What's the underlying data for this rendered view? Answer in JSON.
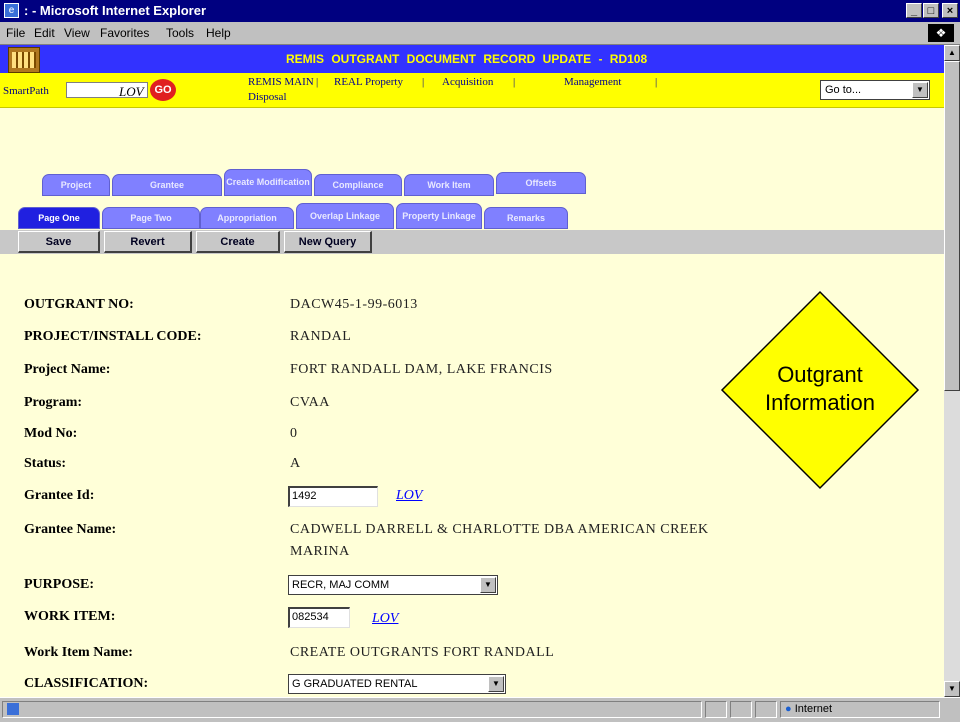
{
  "window": {
    "title": ": - Microsoft Internet Explorer",
    "min": "_",
    "max": "□",
    "close": "×"
  },
  "menu": [
    "File",
    "Edit",
    "View",
    "Favorites",
    "Tools",
    "Help"
  ],
  "app": {
    "header": "REMIS  OUTGRANT  DOCUMENT  RECORD  UPDATE  -  RD108",
    "smartpath_label": "SmartPath",
    "smartpath_value": "",
    "lov_label": "LOV",
    "go_label": "GO",
    "nav": [
      "REMIS MAIN",
      "|",
      "REAL Property",
      "|",
      "Acquisition",
      "|",
      "Management",
      "|",
      "Disposal"
    ],
    "goto_label": "Go to..."
  },
  "tabs_row1": [
    "Project",
    "Grantee",
    "Create Modification",
    "Compliance",
    "Work Item",
    "Offsets"
  ],
  "tabs_row2": [
    "Page One",
    "Page Two",
    "Appropriation",
    "Overlap Linkage",
    "Property Linkage",
    "Remarks"
  ],
  "buttons": {
    "save": "Save",
    "revert": "Revert",
    "create": "Create",
    "new_query": "New Query"
  },
  "form": {
    "outgrant_no": {
      "label": "OUTGRANT NO:",
      "value": "DACW45-1-99-6013"
    },
    "project_code": {
      "label": "PROJECT/INSTALL CODE:",
      "value": "RANDAL"
    },
    "project_name": {
      "label": "Project Name:",
      "value": "FORT RANDALL DAM, LAKE FRANCIS"
    },
    "program": {
      "label": "Program:",
      "value": "CVAA"
    },
    "mod_no": {
      "label": "Mod No:",
      "value": "0"
    },
    "status": {
      "label": "Status:",
      "value": "A"
    },
    "grantee_id": {
      "label": "Grantee Id:",
      "value": "1492",
      "lov": "LOV"
    },
    "grantee_name": {
      "label": "Grantee Name:",
      "value_line1": "CADWELL DARRELL & CHARLOTTE DBA AMERICAN CREEK",
      "value_line2": "MARINA"
    },
    "purpose": {
      "label": "PURPOSE:",
      "value": "RECR, MAJ COMM"
    },
    "work_item": {
      "label": "WORK ITEM:",
      "value": "082534",
      "lov": "LOV"
    },
    "work_item_name": {
      "label": "Work Item Name:",
      "value": "CREATE OUTGRANTS FORT RANDALL"
    },
    "classification": {
      "label": "CLASSIFICATION:",
      "value": "G GRADUATED RENTAL"
    }
  },
  "callout": {
    "line1": "Outgrant",
    "line2": "Information"
  },
  "status": {
    "zone": "Internet"
  },
  "colors": {
    "title_bar": "#000080",
    "app_bar": "#3232ff",
    "nav_bar": "#ffff00",
    "page_bg": "#ffffd8",
    "callout": "#ffff00"
  }
}
